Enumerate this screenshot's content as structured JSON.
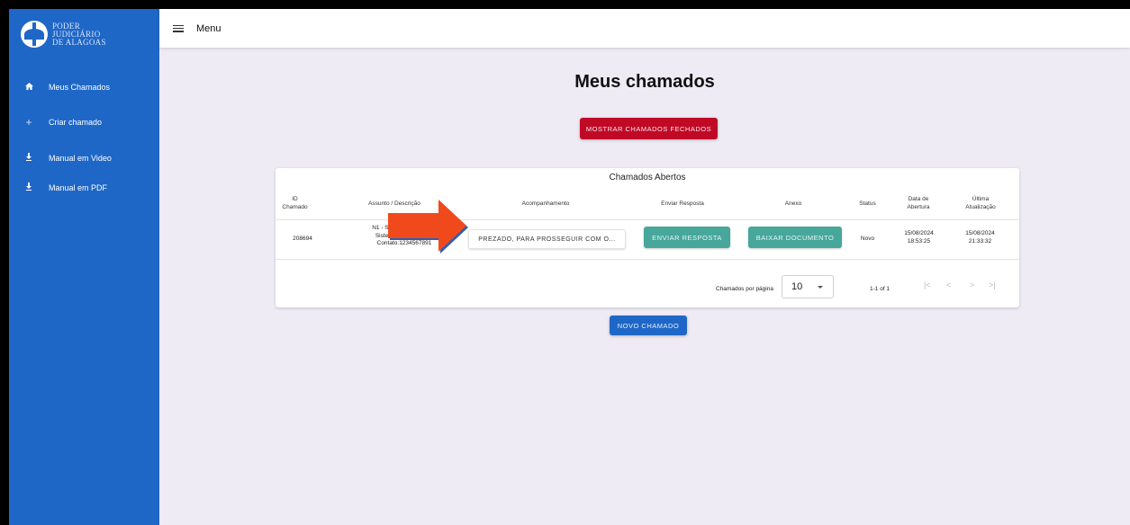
{
  "brand": {
    "line1": "PODER",
    "line2": "JUDICIÁRIO",
    "line3": "DE ALAGOAS"
  },
  "sidebar": {
    "items": [
      {
        "label": "Meus Chamados",
        "icon": "home-icon"
      },
      {
        "label": "Criar chamado",
        "icon": "plus-icon"
      },
      {
        "label": "Manual em Video",
        "icon": "download-icon"
      },
      {
        "label": "Manual em PDF",
        "icon": "download-icon"
      }
    ]
  },
  "topbar": {
    "menu_label": "Menu"
  },
  "page": {
    "title": "Meus chamados",
    "show_closed_label": "MOSTRAR CHAMADOS FECHADOS",
    "new_ticket_label": "NOVO CHAMADO"
  },
  "table": {
    "title": "Chamados Abertos",
    "headers": {
      "id_l1": "ID",
      "id_l2": "Chamado",
      "subject": "Assunto / Descrição",
      "followup": "Acompanhamento",
      "reply": "Enviar Resposta",
      "attachment": "Anexo",
      "status": "Status",
      "opened_l1": "Data de",
      "opened_l2": "Abertura",
      "updated_l1": "Última",
      "updated_l2": "Atualização"
    },
    "rows": [
      {
        "id": "208694",
        "subject_l1": "N1 - Sistema",
        "subject_l2": "Sistema ZO",
        "subject_l3": "Contato:1234567891",
        "followup_label": "PREZADO, PARA PROSSEGUIR COM O...",
        "reply_label": "ENVIAR RESPOSTA",
        "attachment_label": "BAIXAR DOCUMENTO",
        "status": "Novo",
        "opened_date": "15/08/2024",
        "opened_time": "18:53:25",
        "updated_date": "15/08/2024",
        "updated_time": "21:33:32"
      }
    ]
  },
  "pagination": {
    "rows_per_page_label": "Chamados por página",
    "rows_per_page_value": "10",
    "range": "1-1 of 1",
    "first": "|<",
    "prev": "<",
    "next": ">",
    "last": ">|"
  },
  "colors": {
    "sidebar": "#1f67c7",
    "accent_red": "#c00925",
    "accent_teal": "#47a79b",
    "arrow": "#f04a1c",
    "background": "#efebf5"
  }
}
